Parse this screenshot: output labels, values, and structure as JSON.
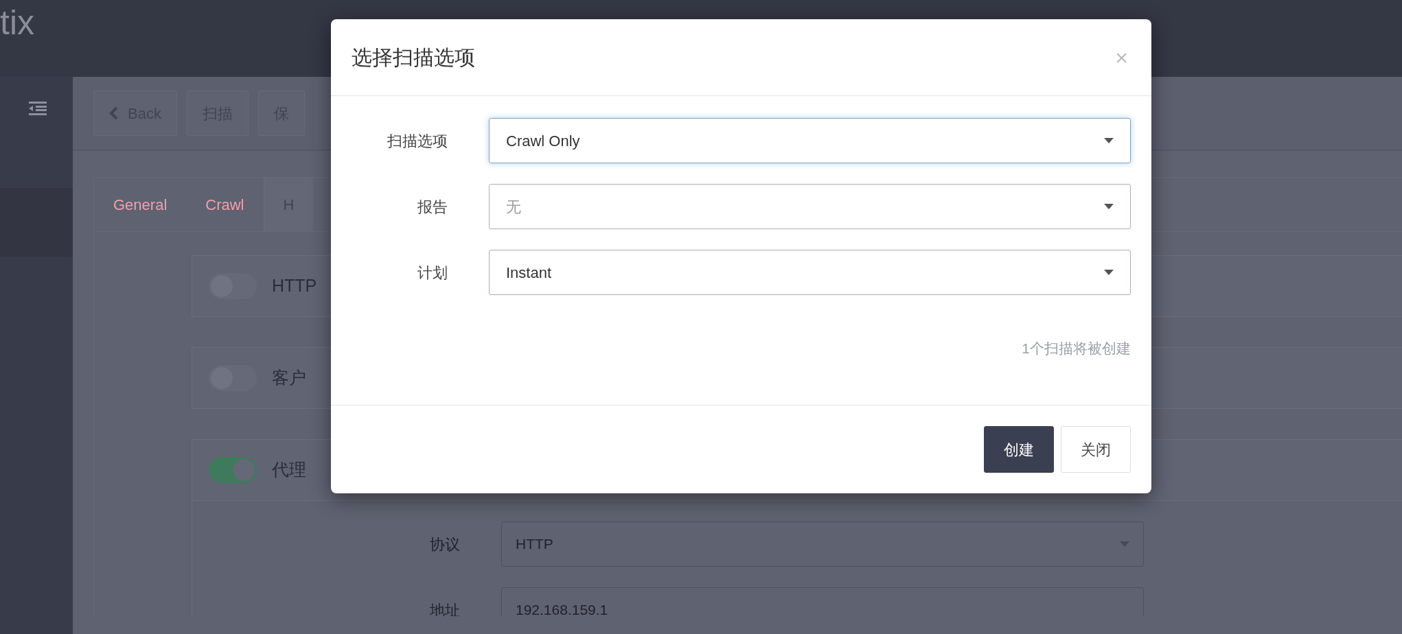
{
  "background": {
    "logo": "tix",
    "toolbar": [
      {
        "label": "Back",
        "kind": "back"
      },
      {
        "label": "扫描",
        "kind": "plain"
      },
      {
        "label": "保",
        "kind": "plain"
      }
    ],
    "tabs": [
      {
        "label": "General",
        "selected": false
      },
      {
        "label": "Crawl",
        "selected": false
      },
      {
        "label": "H",
        "selected": true
      }
    ],
    "toggles": [
      {
        "label": "HTTP",
        "on": false
      },
      {
        "label": "客户",
        "on": false
      },
      {
        "label": "代理",
        "on": true
      }
    ],
    "proxy_fields": [
      {
        "label": "协议",
        "value": "HTTP",
        "kind": "select"
      },
      {
        "label": "地址",
        "value": "192.168.159.1",
        "kind": "input"
      }
    ]
  },
  "modal": {
    "title": "选择扫描选项",
    "close": "×",
    "fields": [
      {
        "label": "扫描选项",
        "value": "Crawl Only",
        "focused": true
      },
      {
        "label": "报告",
        "placeholder": "无",
        "focused": false
      },
      {
        "label": "计划",
        "value": "Instant",
        "focused": false
      }
    ],
    "note": "1个扫描将被创建",
    "buttons": [
      {
        "label": "创建",
        "kind": "primary"
      },
      {
        "label": "关闭",
        "kind": "secondary"
      }
    ]
  }
}
